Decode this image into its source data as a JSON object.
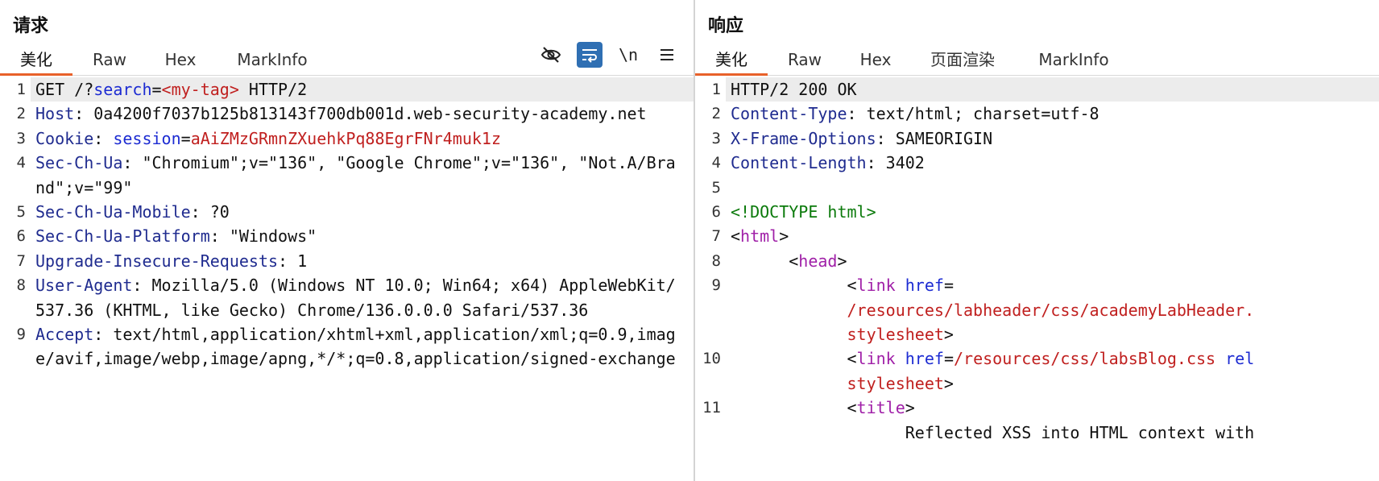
{
  "request": {
    "title": "请求",
    "tabs": [
      "美化",
      "Raw",
      "Hex",
      "MarkInfo"
    ],
    "active_tab": "美化",
    "tools": [
      {
        "name": "hide-icon",
        "glyph": "⊘"
      },
      {
        "name": "wrap-icon",
        "glyph": "↵"
      },
      {
        "name": "newline-icon",
        "glyph": "\\n"
      },
      {
        "name": "menu-icon",
        "glyph": "☰"
      }
    ],
    "lines": [
      {
        "n": "1",
        "parts": [
          {
            "t": "GET /?",
            "c": "p"
          },
          {
            "t": "search",
            "c": "attr"
          },
          {
            "t": "=",
            "c": "p"
          },
          {
            "t": "<my-tag>",
            "c": "v"
          },
          {
            "t": " HTTP/2",
            "c": "p"
          }
        ]
      },
      {
        "n": "2",
        "parts": [
          {
            "t": "Host",
            "c": "k"
          },
          {
            "t": ": 0a4200f7037b125b813143f700db001d.web-security-academy.net",
            "c": "p"
          }
        ]
      },
      {
        "n": "3",
        "parts": [
          {
            "t": "Cookie",
            "c": "k"
          },
          {
            "t": ": ",
            "c": "p"
          },
          {
            "t": "session",
            "c": "attr"
          },
          {
            "t": "=",
            "c": "p"
          },
          {
            "t": "aAiZMzGRmnZXuehkPq88EgrFNr4muk1z",
            "c": "v"
          }
        ]
      },
      {
        "n": "4",
        "parts": [
          {
            "t": "Sec-Ch-Ua",
            "c": "k"
          },
          {
            "t": ": \"Chromium\";v=\"136\", \"Google Chrome\";v=\"136\", \"Not.A/Brand\";v=\"99\"",
            "c": "p"
          }
        ]
      },
      {
        "n": "5",
        "parts": [
          {
            "t": "Sec-Ch-Ua-Mobile",
            "c": "k"
          },
          {
            "t": ": ?0",
            "c": "p"
          }
        ]
      },
      {
        "n": "6",
        "parts": [
          {
            "t": "Sec-Ch-Ua-Platform",
            "c": "k"
          },
          {
            "t": ": \"Windows\"",
            "c": "p"
          }
        ]
      },
      {
        "n": "7",
        "parts": [
          {
            "t": "Upgrade-Insecure-Requests",
            "c": "k"
          },
          {
            "t": ": 1",
            "c": "p"
          }
        ]
      },
      {
        "n": "8",
        "parts": [
          {
            "t": "User-Agent",
            "c": "k"
          },
          {
            "t": ": Mozilla/5.0 (Windows NT 10.0; Win64; x64) AppleWebKit/537.36 (KHTML, like Gecko) Chrome/136.0.0.0 Safari/537.36",
            "c": "p"
          }
        ]
      },
      {
        "n": "9",
        "parts": [
          {
            "t": "Accept",
            "c": "k"
          },
          {
            "t": ": text/html,application/xhtml+xml,application/xml;q=0.9,image/avif,image/webp,image/apng,*/*;q=0.8,application/signed-exchange",
            "c": "p"
          }
        ]
      }
    ]
  },
  "response": {
    "title": "响应",
    "tabs": [
      "美化",
      "Raw",
      "Hex",
      "页面渲染",
      "MarkInfo"
    ],
    "active_tab": "美化",
    "lines": [
      {
        "n": "1",
        "parts": [
          {
            "t": "HTTP/2 200 OK",
            "c": "p"
          }
        ]
      },
      {
        "n": "2",
        "parts": [
          {
            "t": "Content-Type",
            "c": "k"
          },
          {
            "t": ": text/html; charset=utf-8",
            "c": "p"
          }
        ]
      },
      {
        "n": "3",
        "parts": [
          {
            "t": "X-Frame-Options",
            "c": "k"
          },
          {
            "t": ": SAMEORIGIN",
            "c": "p"
          }
        ]
      },
      {
        "n": "4",
        "parts": [
          {
            "t": "Content-Length",
            "c": "k"
          },
          {
            "t": ": 3402",
            "c": "p"
          }
        ]
      },
      {
        "n": "5",
        "parts": []
      },
      {
        "n": "6",
        "parts": [
          {
            "t": "<!DOCTYPE html>",
            "c": "doc"
          }
        ]
      },
      {
        "n": "7",
        "parts": [
          {
            "t": "<",
            "c": "p"
          },
          {
            "t": "html",
            "c": "tag"
          },
          {
            "t": ">",
            "c": "p"
          }
        ]
      },
      {
        "n": "8",
        "parts": [
          {
            "t": "      <",
            "c": "p"
          },
          {
            "t": "head",
            "c": "tag"
          },
          {
            "t": ">",
            "c": "p"
          }
        ]
      },
      {
        "n": "9",
        "parts": [
          {
            "t": "            <",
            "c": "p"
          },
          {
            "t": "link",
            "c": "tag"
          },
          {
            "t": " ",
            "c": "p"
          },
          {
            "t": "href",
            "c": "attr"
          },
          {
            "t": "=",
            "c": "p"
          }
        ]
      },
      {
        "n": "",
        "parts": [
          {
            "t": "            /resources/labheader/css/academyLabHeader.",
            "c": "v"
          }
        ]
      },
      {
        "n": "",
        "parts": [
          {
            "t": "            stylesheet",
            "c": "v"
          },
          {
            "t": ">",
            "c": "p"
          }
        ]
      },
      {
        "n": "10",
        "parts": [
          {
            "t": "            <",
            "c": "p"
          },
          {
            "t": "link",
            "c": "tag"
          },
          {
            "t": " ",
            "c": "p"
          },
          {
            "t": "href",
            "c": "attr"
          },
          {
            "t": "=",
            "c": "p"
          },
          {
            "t": "/resources/css/labsBlog.css",
            "c": "v"
          },
          {
            "t": " ",
            "c": "p"
          },
          {
            "t": "rel",
            "c": "attr"
          }
        ]
      },
      {
        "n": "",
        "parts": [
          {
            "t": "            stylesheet",
            "c": "v"
          },
          {
            "t": ">",
            "c": "p"
          }
        ]
      },
      {
        "n": "11",
        "parts": [
          {
            "t": "            <",
            "c": "p"
          },
          {
            "t": "title",
            "c": "tag"
          },
          {
            "t": ">",
            "c": "p"
          }
        ]
      },
      {
        "n": "",
        "parts": [
          {
            "t": "                  Reflected XSS into HTML context with",
            "c": "p"
          }
        ]
      }
    ]
  }
}
